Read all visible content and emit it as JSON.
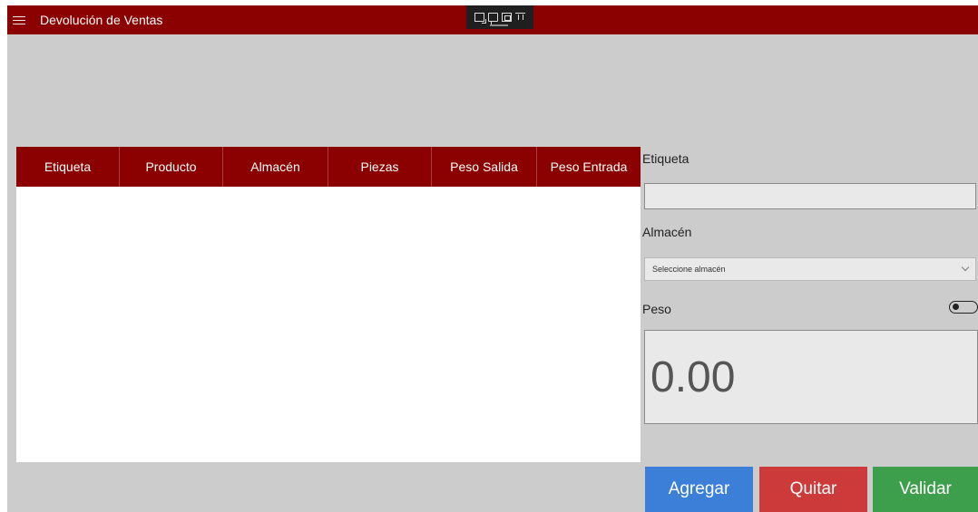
{
  "app": {
    "title": "Devolución de Ventas"
  },
  "toolbar_overlay": {
    "icons": [
      "select-icon",
      "comment-icon",
      "frame-icon",
      "pin-icon"
    ]
  },
  "grid": {
    "columns": [
      "Etiqueta",
      "Producto",
      "Almacén",
      "Piezas",
      "Peso Salida",
      "Peso Entrada"
    ],
    "rows": []
  },
  "form": {
    "etiqueta_label": "Etiqueta",
    "etiqueta_value": "",
    "almacen_label": "Almacén",
    "almacen_placeholder": "Seleccione almacén",
    "peso_label": "Peso",
    "peso_toggle_on": false,
    "peso_value": "0.00"
  },
  "actions": {
    "agregar": "Agregar",
    "quitar": "Quitar",
    "validar": "Validar"
  },
  "colors": {
    "header": "#8b0000",
    "background": "#cccccc",
    "agregar": "#3b7fd9",
    "quitar": "#cd3a3a",
    "validar": "#3d9e4c"
  }
}
